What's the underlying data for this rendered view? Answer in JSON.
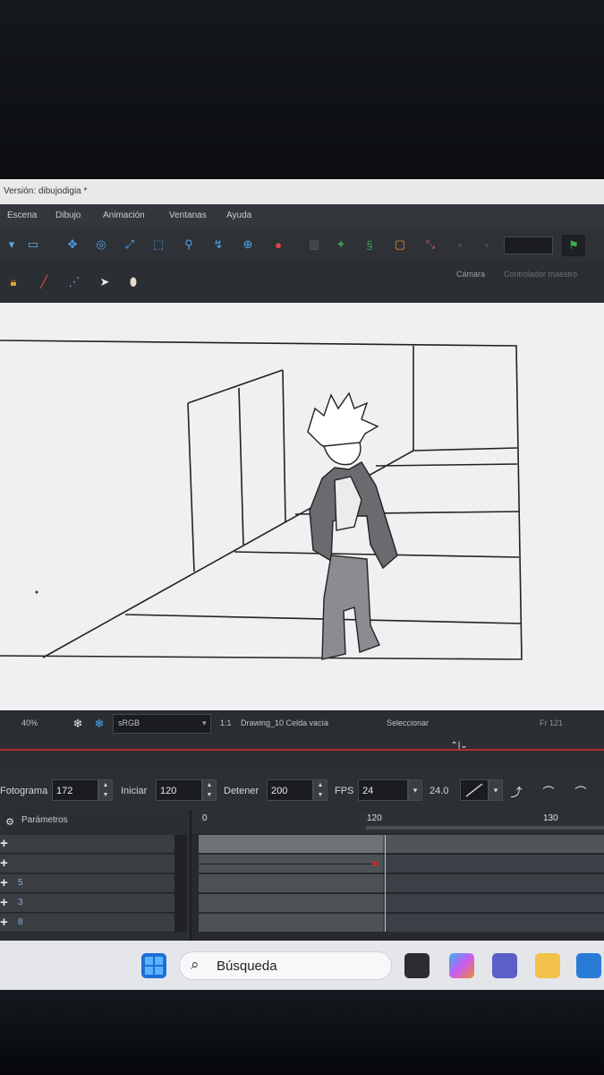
{
  "window": {
    "title": "Versión: dibujodigia *"
  },
  "menu": [
    "Escena",
    "Dibujo",
    "Animación",
    "Ventanas",
    "Ayuda"
  ],
  "camera_bar": {
    "camera": "Cámara",
    "controller": "Controlador maestro"
  },
  "status": {
    "zoom": "40%",
    "color_space": "sRGB",
    "ratio": "1:1",
    "drawing": "Drawing_10 Celda vacía",
    "tool": "Seleccionar",
    "frame": "Fr 121"
  },
  "frame_controls": {
    "frame_label": "Fotograma",
    "frame_value": "172",
    "start_label": "Iniciar",
    "start_value": "120",
    "stop_label": "Detener",
    "stop_value": "200",
    "fps_label": "FPS",
    "fps_value": "24",
    "fps_readout": "24.0"
  },
  "timeline": {
    "params_label": "Parámetros",
    "ruler": [
      "0",
      "120",
      "130"
    ],
    "layers": [
      {
        "name": ""
      },
      {
        "name": ""
      },
      {
        "name": "5"
      },
      {
        "name": "3"
      },
      {
        "name": "8"
      }
    ]
  },
  "taskbar": {
    "search_text": "Búsqueda"
  },
  "colors": {
    "accent_red": "#b42a2a",
    "panel_dark": "#2b2e33",
    "layer_blue": "#7fb2ee"
  }
}
